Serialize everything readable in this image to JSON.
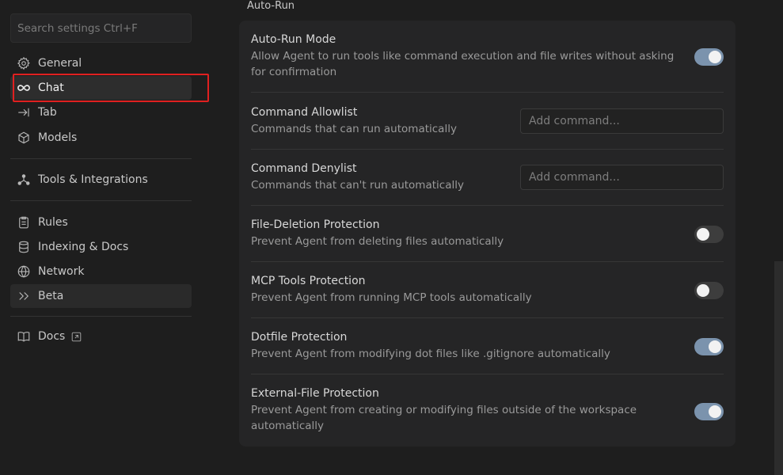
{
  "search": {
    "placeholder": "Search settings Ctrl+F"
  },
  "sidebar": {
    "items": [
      {
        "label": "General",
        "icon": "gear-icon"
      },
      {
        "label": "Chat",
        "icon": "infinity-icon"
      },
      {
        "label": "Tab",
        "icon": "arrow-right-bar-icon"
      },
      {
        "label": "Models",
        "icon": "cube-icon"
      },
      {
        "label": "Tools & Integrations",
        "icon": "network-nodes-icon"
      },
      {
        "label": "Rules",
        "icon": "clipboard-icon"
      },
      {
        "label": "Indexing & Docs",
        "icon": "database-icon"
      },
      {
        "label": "Network",
        "icon": "globe-icon"
      },
      {
        "label": "Beta",
        "icon": "double-chevron-icon"
      },
      {
        "label": "Docs",
        "icon": "book-icon"
      }
    ]
  },
  "main": {
    "section_title": "Auto-Run",
    "settings": [
      {
        "title": "Auto-Run Mode",
        "description": "Allow Agent to run tools like command execution and file writes without asking for confirmation",
        "control": "toggle",
        "enabled": true
      },
      {
        "title": "Command Allowlist",
        "description": "Commands that can run automatically",
        "control": "input",
        "placeholder": "Add command..."
      },
      {
        "title": "Command Denylist",
        "description": "Commands that can't run automatically",
        "control": "input",
        "placeholder": "Add command..."
      },
      {
        "title": "File-Deletion Protection",
        "description": "Prevent Agent from deleting files automatically",
        "control": "toggle",
        "enabled": false
      },
      {
        "title": "MCP Tools Protection",
        "description": "Prevent Agent from running MCP tools automatically",
        "control": "toggle",
        "enabled": false
      },
      {
        "title": "Dotfile Protection",
        "description": "Prevent Agent from modifying dot files like .gitignore automatically",
        "control": "toggle",
        "enabled": true
      },
      {
        "title": "External-File Protection",
        "description": "Prevent Agent from creating or modifying files outside of the workspace automatically",
        "control": "toggle",
        "enabled": true
      }
    ]
  },
  "colors": {
    "toggle_on": "#7b93ad",
    "toggle_off": "#3d3d3d",
    "highlight": "#e02020",
    "panel": "#252526",
    "background": "#1e1e1e"
  }
}
